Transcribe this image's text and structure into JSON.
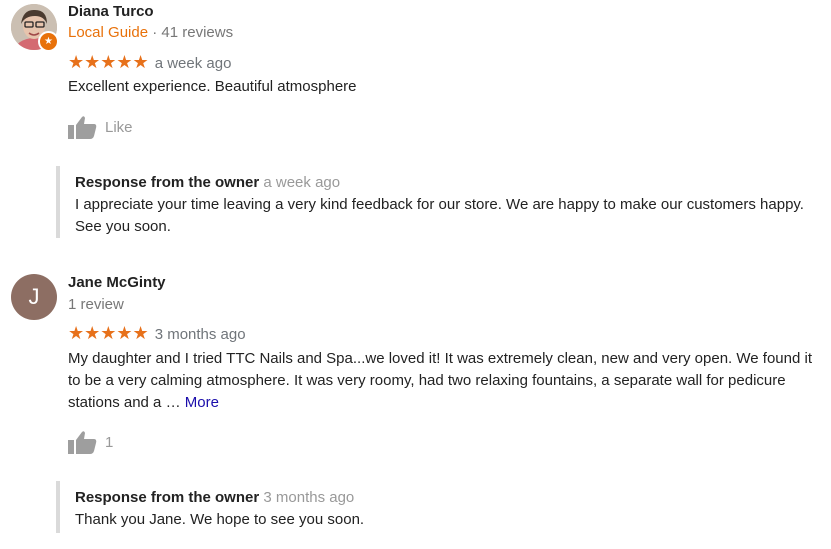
{
  "reviews": [
    {
      "author": "Diana Turco",
      "local_guide": "Local Guide",
      "separator": " · ",
      "review_count": "41 reviews",
      "stars": "★★★★★",
      "time": "a week ago",
      "text": "Excellent experience. Beautiful atmosphere",
      "like_label": "Like",
      "owner_title": "Response from the owner",
      "owner_time": "a week ago",
      "owner_text": "I appreciate your time leaving a very kind feedback for our store. We are happy to make our customers happy. See you soon."
    },
    {
      "author": "Jane McGinty",
      "avatar_letter": "J",
      "review_count": "1 review",
      "stars": "★★★★★",
      "time": "3 months ago",
      "text": "My daughter  and I tried TTC Nails and Spa...we loved it! It was extremely clean, new and very open. We found it to be a very calming atmosphere. It was very roomy, had two relaxing fountains, a separate wall for pedicure stations and a … ",
      "more_label": "More",
      "like_count": "1",
      "owner_title": "Response from the owner",
      "owner_time": "3 months ago",
      "owner_text": "Thank you Jane. We hope to see you soon."
    }
  ],
  "colors": {
    "star": "#e7711b",
    "local_guide": "#e8710a",
    "link": "#1a0dab",
    "avatar_j": "#8d6e63",
    "muted": "#777777"
  }
}
